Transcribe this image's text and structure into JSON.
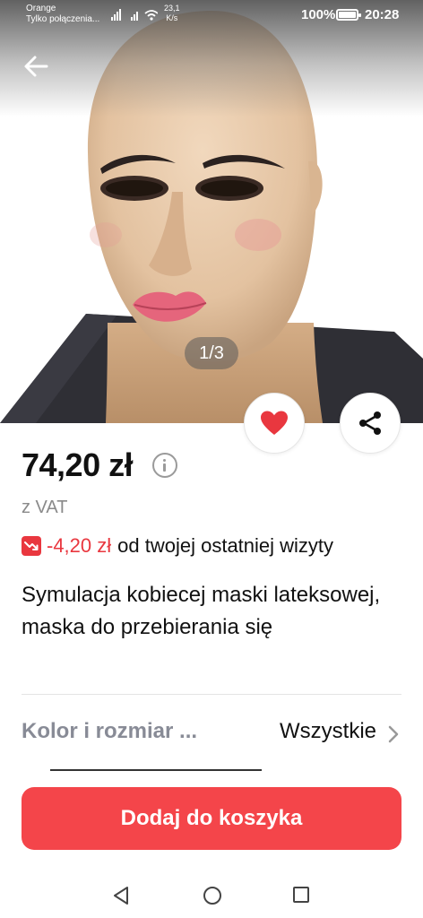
{
  "status_bar": {
    "carrier": "Orange",
    "carrier_sub": "Tylko połączenia...",
    "network_speed_value": "23,1",
    "network_speed_unit": "K/s",
    "battery": "100%",
    "time": "20:28"
  },
  "gallery": {
    "counter": "1/3",
    "current_image": 1,
    "total_images": 3
  },
  "product": {
    "price": "74,20 zł",
    "vat_note": "z VAT",
    "price_drop_amount": "-4,20 zł",
    "price_drop_text": "od twojej ostatniej wizyty",
    "title": "Symulacja kobiecej maski lateksowej, maska do przebierania się"
  },
  "variant": {
    "label": "Kolor i rozmiar ...",
    "value": "Wszystkie"
  },
  "actions": {
    "add_to_cart": "Dodaj do koszyka"
  },
  "colors": {
    "accent": "#f4454a",
    "price_drop": "#e9373f",
    "favorite_heart": "#e9373f"
  },
  "icons": {
    "back": "arrow-left-icon",
    "favorite": "heart-icon",
    "share": "share-icon",
    "info": "info-icon",
    "price_drop": "trend-down-icon",
    "chevron": "chevron-right-icon"
  }
}
